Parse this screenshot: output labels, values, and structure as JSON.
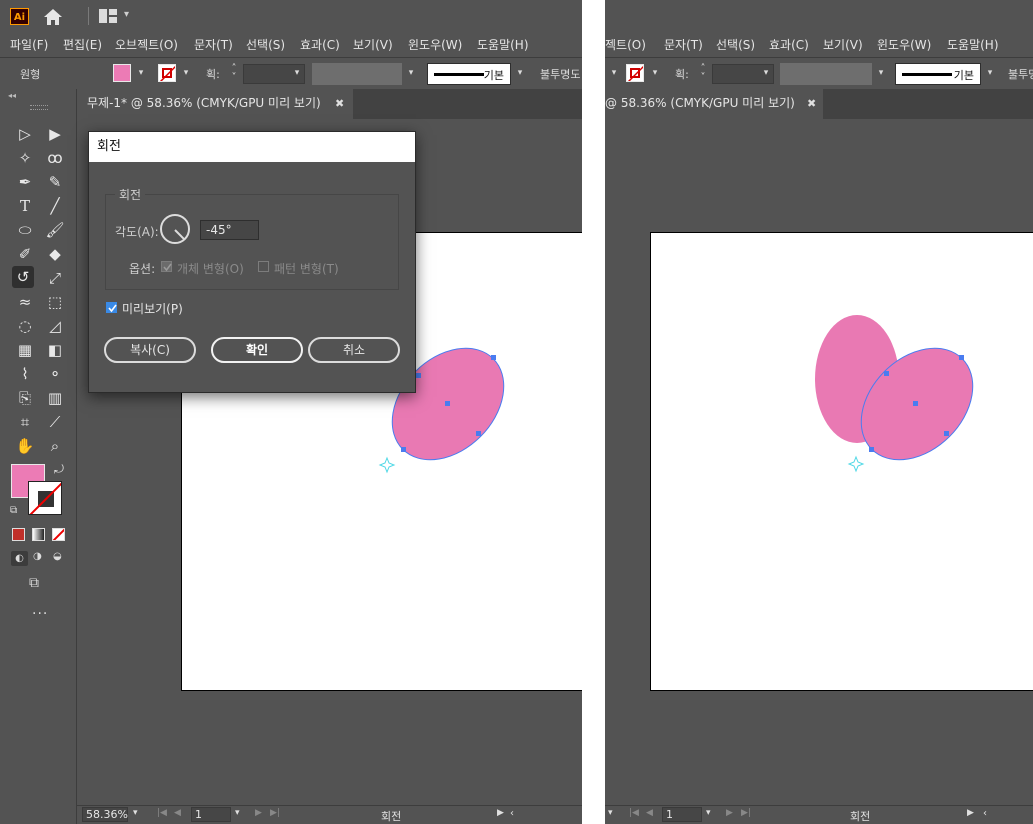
{
  "app": {
    "logo_text": "Ai",
    "icons": [
      "home-icon",
      "workspace-switcher-icon"
    ]
  },
  "menu": [
    "파일(F)",
    "편집(E)",
    "오브젝트(O)",
    "문자(T)",
    "선택(S)",
    "효과(C)",
    "보기(V)",
    "윈도우(W)",
    "도움말(H)"
  ],
  "menu_right": [
    "젝트(O)",
    "문자(T)",
    "선택(S)",
    "효과(C)",
    "보기(V)",
    "윈도우(W)",
    "도움말(H)"
  ],
  "control_bar": {
    "object_label": "원형",
    "stroke_label": "획:",
    "stroke_style": "기본",
    "opacity_label": "불투명도",
    "opacity_label_right": "불투명",
    "fill_color": "#ec7bb5"
  },
  "document": {
    "tab_title": "무제-1* @ 58.36% (CMYK/GPU 미리 보기)",
    "tab_title_right": "@ 58.36% (CMYK/GPU 미리 보기)",
    "close_glyph": "✖"
  },
  "status": {
    "zoom": "58.36%",
    "page": "1",
    "tool_name": "회전"
  },
  "rotate_dialog": {
    "title": "회전",
    "group_label": "회전",
    "angle_label": "각도(A):",
    "angle_value": "-45°",
    "options_label": "옵션:",
    "transform_objects": "개체 변형(O)",
    "transform_patterns": "패턴 변형(T)",
    "preview_label": "미리보기(P)",
    "preview_checked": true,
    "copy_button": "복사(C)",
    "ok_button": "확인",
    "cancel_button": "취소"
  },
  "colors": {
    "panel_bg": "#535353",
    "ellipse_fill": "#e979b3",
    "selection": "#4a7cf0",
    "artboard": "#ffffff"
  }
}
